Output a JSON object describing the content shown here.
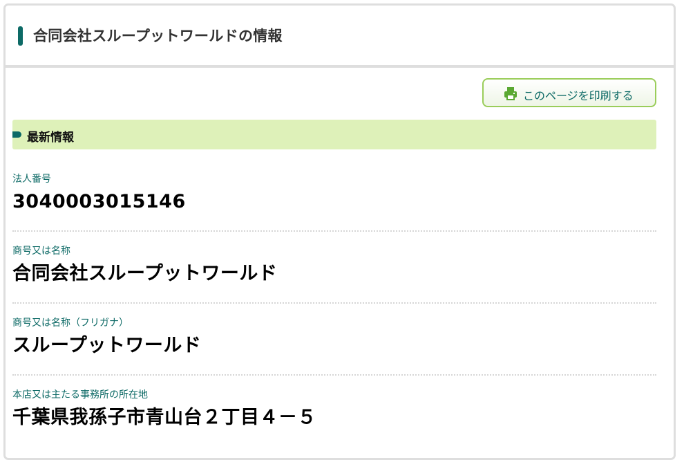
{
  "header": {
    "title": "合同会社スループットワールドの情報"
  },
  "print_button": {
    "label": "このページを印刷する",
    "icon": "printer-icon"
  },
  "section": {
    "title": "最新情報"
  },
  "fields": [
    {
      "label": "法人番号",
      "value": "3040003015146"
    },
    {
      "label": "商号又は名称",
      "value": "合同会社スループットワールド"
    },
    {
      "label": "商号又は名称（フリガナ）",
      "value": "スループットワールド"
    },
    {
      "label": "本店又は主たる事務所の所在地",
      "value": "千葉県我孫子市青山台２丁目４－５"
    }
  ],
  "colors": {
    "accent": "#0d6a66",
    "section_bg": "#def1b9",
    "button_border": "#9acd5a",
    "card_border": "#dedede"
  }
}
